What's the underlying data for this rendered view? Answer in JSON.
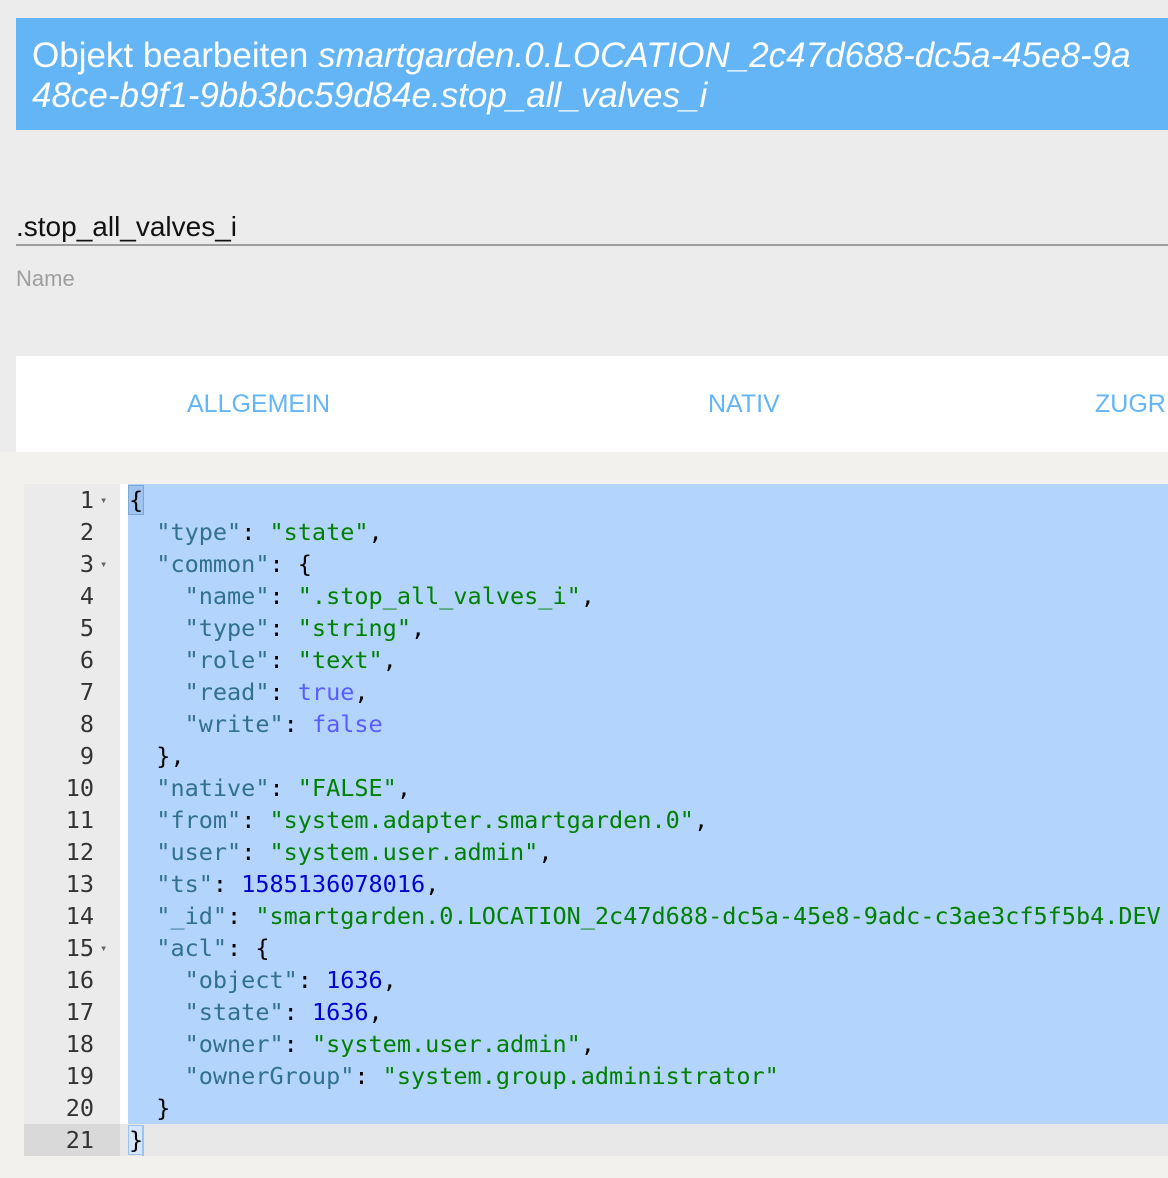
{
  "dialog": {
    "title_prefix": "Objekt bearbeiten",
    "object_id_line1": "smartgarden.0.LOCATION_2c47d688-dc5a-45e8-9a",
    "object_id_line2": "48ce-b9f1-9bb3bc59d84e.stop_all_valves_i"
  },
  "name_field": {
    "value": ".stop_all_valves_i",
    "label": "Name"
  },
  "tabs": [
    "ALLGEMEIN",
    "NATIV",
    "ZUGRI"
  ],
  "editor": {
    "lines": [
      {
        "n": "1",
        "fold": true,
        "tokens": [
          {
            "t": "p",
            "v": "{"
          }
        ]
      },
      {
        "n": "2",
        "tokens": [
          {
            "t": "p",
            "v": "  "
          },
          {
            "t": "k",
            "v": "\"type\""
          },
          {
            "t": "p",
            "v": ": "
          },
          {
            "t": "s",
            "v": "\"state\""
          },
          {
            "t": "p",
            "v": ","
          }
        ]
      },
      {
        "n": "3",
        "fold": true,
        "tokens": [
          {
            "t": "p",
            "v": "  "
          },
          {
            "t": "k",
            "v": "\"common\""
          },
          {
            "t": "p",
            "v": ": {"
          }
        ]
      },
      {
        "n": "4",
        "tokens": [
          {
            "t": "p",
            "v": "    "
          },
          {
            "t": "k",
            "v": "\"name\""
          },
          {
            "t": "p",
            "v": ": "
          },
          {
            "t": "s",
            "v": "\".stop_all_valves_i\""
          },
          {
            "t": "p",
            "v": ","
          }
        ]
      },
      {
        "n": "5",
        "tokens": [
          {
            "t": "p",
            "v": "    "
          },
          {
            "t": "k",
            "v": "\"type\""
          },
          {
            "t": "p",
            "v": ": "
          },
          {
            "t": "s",
            "v": "\"string\""
          },
          {
            "t": "p",
            "v": ","
          }
        ]
      },
      {
        "n": "6",
        "tokens": [
          {
            "t": "p",
            "v": "    "
          },
          {
            "t": "k",
            "v": "\"role\""
          },
          {
            "t": "p",
            "v": ": "
          },
          {
            "t": "s",
            "v": "\"text\""
          },
          {
            "t": "p",
            "v": ","
          }
        ]
      },
      {
        "n": "7",
        "tokens": [
          {
            "t": "p",
            "v": "    "
          },
          {
            "t": "k",
            "v": "\"read\""
          },
          {
            "t": "p",
            "v": ": "
          },
          {
            "t": "b",
            "v": "true"
          },
          {
            "t": "p",
            "v": ","
          }
        ]
      },
      {
        "n": "8",
        "tokens": [
          {
            "t": "p",
            "v": "    "
          },
          {
            "t": "k",
            "v": "\"write\""
          },
          {
            "t": "p",
            "v": ": "
          },
          {
            "t": "b",
            "v": "false"
          }
        ]
      },
      {
        "n": "9",
        "tokens": [
          {
            "t": "p",
            "v": "  },"
          }
        ]
      },
      {
        "n": "10",
        "tokens": [
          {
            "t": "p",
            "v": "  "
          },
          {
            "t": "k",
            "v": "\"native\""
          },
          {
            "t": "p",
            "v": ": "
          },
          {
            "t": "s",
            "v": "\"FALSE\""
          },
          {
            "t": "p",
            "v": ","
          }
        ]
      },
      {
        "n": "11",
        "tokens": [
          {
            "t": "p",
            "v": "  "
          },
          {
            "t": "k",
            "v": "\"from\""
          },
          {
            "t": "p",
            "v": ": "
          },
          {
            "t": "s",
            "v": "\"system.adapter.smartgarden.0\""
          },
          {
            "t": "p",
            "v": ","
          }
        ]
      },
      {
        "n": "12",
        "tokens": [
          {
            "t": "p",
            "v": "  "
          },
          {
            "t": "k",
            "v": "\"user\""
          },
          {
            "t": "p",
            "v": ": "
          },
          {
            "t": "s",
            "v": "\"system.user.admin\""
          },
          {
            "t": "p",
            "v": ","
          }
        ]
      },
      {
        "n": "13",
        "tokens": [
          {
            "t": "p",
            "v": "  "
          },
          {
            "t": "k",
            "v": "\"ts\""
          },
          {
            "t": "p",
            "v": ": "
          },
          {
            "t": "n",
            "v": "1585136078016"
          },
          {
            "t": "p",
            "v": ","
          }
        ]
      },
      {
        "n": "14",
        "tokens": [
          {
            "t": "p",
            "v": "  "
          },
          {
            "t": "k",
            "v": "\"_id\""
          },
          {
            "t": "p",
            "v": ": "
          },
          {
            "t": "s",
            "v": "\"smartgarden.0.LOCATION_2c47d688-dc5a-45e8-9adc-c3ae3cf5f5b4.DEV"
          }
        ]
      },
      {
        "n": "15",
        "fold": true,
        "tokens": [
          {
            "t": "p",
            "v": "  "
          },
          {
            "t": "k",
            "v": "\"acl\""
          },
          {
            "t": "p",
            "v": ": {"
          }
        ]
      },
      {
        "n": "16",
        "tokens": [
          {
            "t": "p",
            "v": "    "
          },
          {
            "t": "k",
            "v": "\"object\""
          },
          {
            "t": "p",
            "v": ": "
          },
          {
            "t": "n",
            "v": "1636"
          },
          {
            "t": "p",
            "v": ","
          }
        ]
      },
      {
        "n": "17",
        "tokens": [
          {
            "t": "p",
            "v": "    "
          },
          {
            "t": "k",
            "v": "\"state\""
          },
          {
            "t": "p",
            "v": ": "
          },
          {
            "t": "n",
            "v": "1636"
          },
          {
            "t": "p",
            "v": ","
          }
        ]
      },
      {
        "n": "18",
        "tokens": [
          {
            "t": "p",
            "v": "    "
          },
          {
            "t": "k",
            "v": "\"owner\""
          },
          {
            "t": "p",
            "v": ": "
          },
          {
            "t": "s",
            "v": "\"system.user.admin\""
          },
          {
            "t": "p",
            "v": ","
          }
        ]
      },
      {
        "n": "19",
        "tokens": [
          {
            "t": "p",
            "v": "    "
          },
          {
            "t": "k",
            "v": "\"ownerGroup\""
          },
          {
            "t": "p",
            "v": ": "
          },
          {
            "t": "s",
            "v": "\"system.group.administrator\""
          }
        ]
      },
      {
        "n": "20",
        "tokens": [
          {
            "t": "p",
            "v": "  }"
          }
        ]
      },
      {
        "n": "21",
        "tokens": [
          {
            "t": "p",
            "v": "}"
          }
        ]
      }
    ]
  },
  "icons": {
    "fold": "fold-arrow-icon"
  },
  "colors": {
    "title_bar": "#64b5f6",
    "tab_text": "#64b5f6",
    "selection": "#b3d4fc"
  }
}
